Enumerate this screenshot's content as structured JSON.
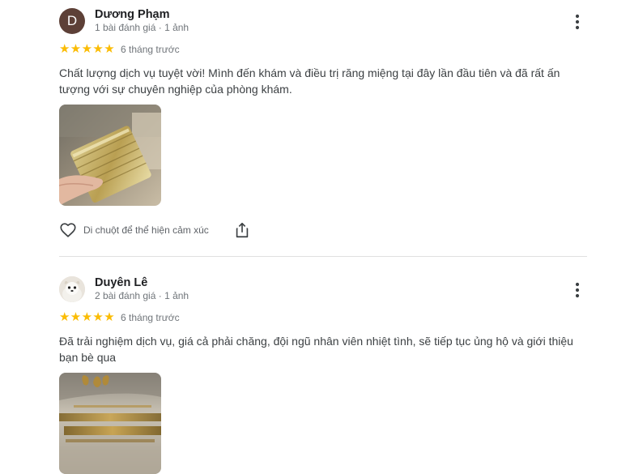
{
  "reviews": [
    {
      "name": "Dương Phạm",
      "avatar_letter": "D",
      "meta": "1 bài đánh giá · 1 ảnh",
      "rating": 5,
      "stars": "★★★★★",
      "date": "6 tháng trước",
      "text": "Chất lượng dịch vụ tuyệt vời! Mình đến khám và điều trị răng miệng tại đây lần đầu tiên và đã rất ấn tượng với sự chuyên nghiệp của phòng khám.",
      "like_label": "Di chuột để thể hiện cảm xúc"
    },
    {
      "name": "Duyên Lê",
      "meta": "2 bài đánh giá · 1 ảnh",
      "rating": 5,
      "stars": "★★★★★",
      "date": "6 tháng trước",
      "text": "Đã trải nghiệm dịch vụ, giá cả phải chăng, đội ngũ nhân viên nhiệt tình, sẽ tiếp tục ủng hộ và giới thiệu bạn bè qua"
    }
  ],
  "colors": {
    "star": "#fbbc04",
    "avatar_bg": "#5d4037",
    "meta": "#70757a",
    "text": "#3c4043"
  },
  "icons": [
    "more-vert-icon",
    "star-icon",
    "heart-outline-icon",
    "share-icon"
  ]
}
